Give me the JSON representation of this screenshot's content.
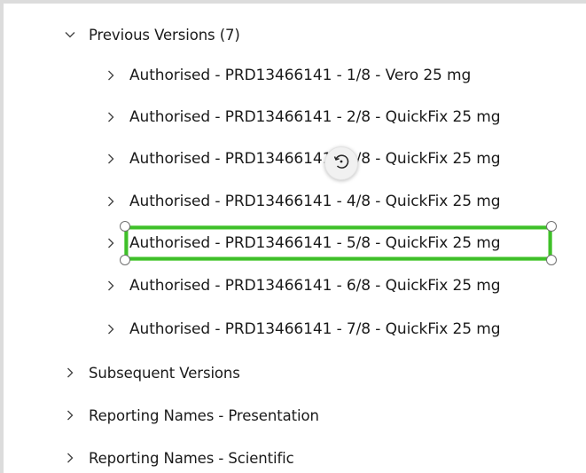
{
  "tree": {
    "previous_versions": {
      "label": "Previous Versions (7)",
      "expanded": true,
      "children": [
        {
          "label": "Authorised - PRD13466141 - 1/8 - Vero 25 mg"
        },
        {
          "label": "Authorised - PRD13466141 - 2/8 - QuickFix 25 mg"
        },
        {
          "label": "Authorised - PRD13466141 - 3/8 - QuickFix 25 mg"
        },
        {
          "label": "Authorised - PRD13466141 - 4/8 - QuickFix 25 mg"
        },
        {
          "label": "Authorised - PRD13466141 - 5/8 - QuickFix 25 mg",
          "selected": true
        },
        {
          "label": "Authorised - PRD13466141 - 6/8 - QuickFix 25 mg"
        },
        {
          "label": "Authorised - PRD13466141 - 7/8 - QuickFix 25 mg"
        }
      ]
    },
    "subsequent_versions": {
      "label": "Subsequent Versions",
      "expanded": false
    },
    "reporting_presentation": {
      "label": "Reporting Names - Presentation",
      "expanded": false
    },
    "reporting_scientific": {
      "label": "Reporting Names - Scientific",
      "expanded": false
    }
  },
  "icons": {
    "expanded": "chevron-down-icon",
    "collapsed": "chevron-right-icon",
    "rotate": "rotate-icon"
  },
  "colors": {
    "selection_border": "#3fbf2a",
    "text": "#1a1a1a",
    "chevron": "#444444",
    "background": "#ffffff"
  }
}
